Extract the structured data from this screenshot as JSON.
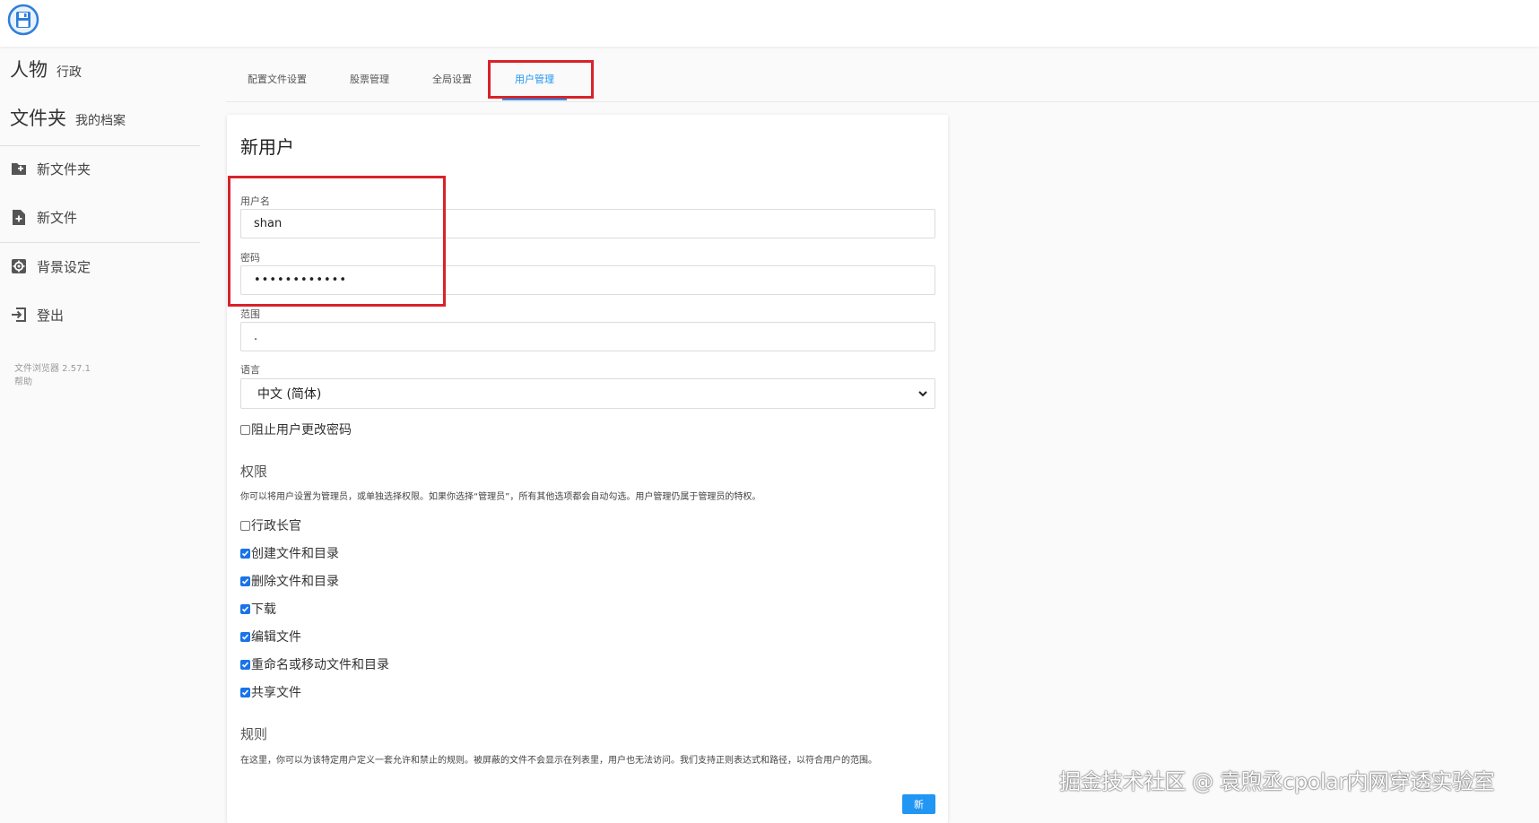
{
  "header": {
    "logo_icon": "floppy-disk-logo-icon"
  },
  "sidebar": {
    "people": {
      "big": "人物",
      "small": "行政"
    },
    "folder": {
      "big": "文件夹",
      "small": "我的档案"
    },
    "items": [
      {
        "label": "新文件夹",
        "icon": "folder-plus-icon"
      },
      {
        "label": "新文件",
        "icon": "file-plus-icon"
      },
      {
        "label": "背景设定",
        "icon": "gear-icon"
      },
      {
        "label": "登出",
        "icon": "logout-icon"
      }
    ],
    "version": "文件浏览器 2.57.1",
    "help": "帮助"
  },
  "tabs": [
    {
      "label": "配置文件设置",
      "active": false
    },
    {
      "label": "股票管理",
      "active": false
    },
    {
      "label": "全局设置",
      "active": false
    },
    {
      "label": "用户管理",
      "active": true
    }
  ],
  "form": {
    "title": "新用户",
    "username_label": "用户名",
    "username_value": "shan",
    "password_label": "密码",
    "password_value": "••••••••••••",
    "scope_label": "范围",
    "scope_value": ".",
    "language_label": "语言",
    "language_value": "中文 (简体)",
    "lock_password_label": "阻止用户更改密码",
    "lock_password_checked": false
  },
  "permissions": {
    "title": "权限",
    "description": "你可以将用户设置为管理员，或单独选择权限。如果你选择“管理员”，所有其他选项都会自动勾选。用户管理仍属于管理员的特权。",
    "items": [
      {
        "label": "行政长官",
        "checked": false
      },
      {
        "label": "创建文件和目录",
        "checked": true
      },
      {
        "label": "删除文件和目录",
        "checked": true
      },
      {
        "label": "下载",
        "checked": true
      },
      {
        "label": "编辑文件",
        "checked": true
      },
      {
        "label": "重命名或移动文件和目录",
        "checked": true
      },
      {
        "label": "共享文件",
        "checked": true
      }
    ]
  },
  "rules": {
    "title": "规则",
    "description": "在这里，你可以为该特定用户定义一套允许和禁止的规则。被屏蔽的文件不会显示在列表里，用户也无法访问。我们支持正则表达式和路径，以符合用户的范围。"
  },
  "actions": {
    "new_label": "新"
  },
  "watermark": "掘金技术社区 @ 袁煦丞cpolar内网穿透实验室",
  "colors": {
    "accent": "#2196f3",
    "highlight_outline": "#d8232a"
  }
}
